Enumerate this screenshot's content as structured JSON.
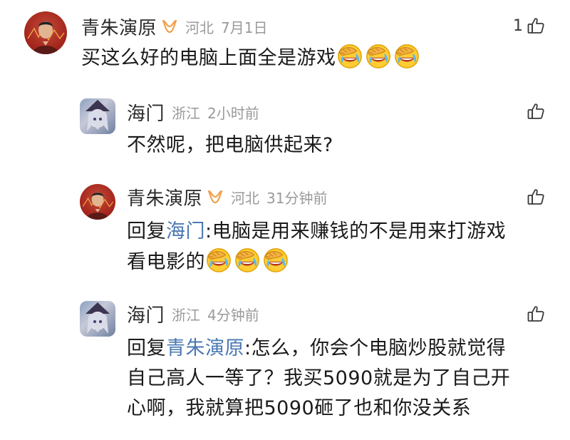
{
  "comments": [
    {
      "username": "青朱演原",
      "location": "河北",
      "time": "7月1日",
      "likes": "1",
      "content": "买这么好的电脑上面全是游戏",
      "emoji_count": 3
    },
    {
      "username": "海门",
      "location": "浙江",
      "time": "2小时前",
      "content": "不然呢，把电脑供起来?"
    },
    {
      "username": "青朱演原",
      "location": "河北",
      "time": "31分钟前",
      "reply_prefix": "回复",
      "reply_to": "海门",
      "reply_sep": ":",
      "content_line1": "电脑是用来赚钱的不是用来打游戏",
      "content_line2": "看电影的",
      "emoji_count": 3
    },
    {
      "username": "海门",
      "location": "浙江",
      "time": "4分钟前",
      "reply_prefix": "回复",
      "reply_to": "青朱演原",
      "reply_sep": ":",
      "content_line1": "怎么，你会个电脑炒股就觉得",
      "content_line2": "自己高人一等了？我买5090就是为了自己开",
      "content_line3": "心啊，我就算把5090砸了也和你没关系"
    }
  ],
  "icons": {
    "like": "thumbs-up-outline-icon",
    "vip": "vip-badge-icon",
    "emoji": "facepalm-laughing-emoji"
  },
  "colors": {
    "mention": "#4a78b3",
    "meta_gray": "#9a9a9a",
    "vip_orange": "#f0a04b"
  }
}
